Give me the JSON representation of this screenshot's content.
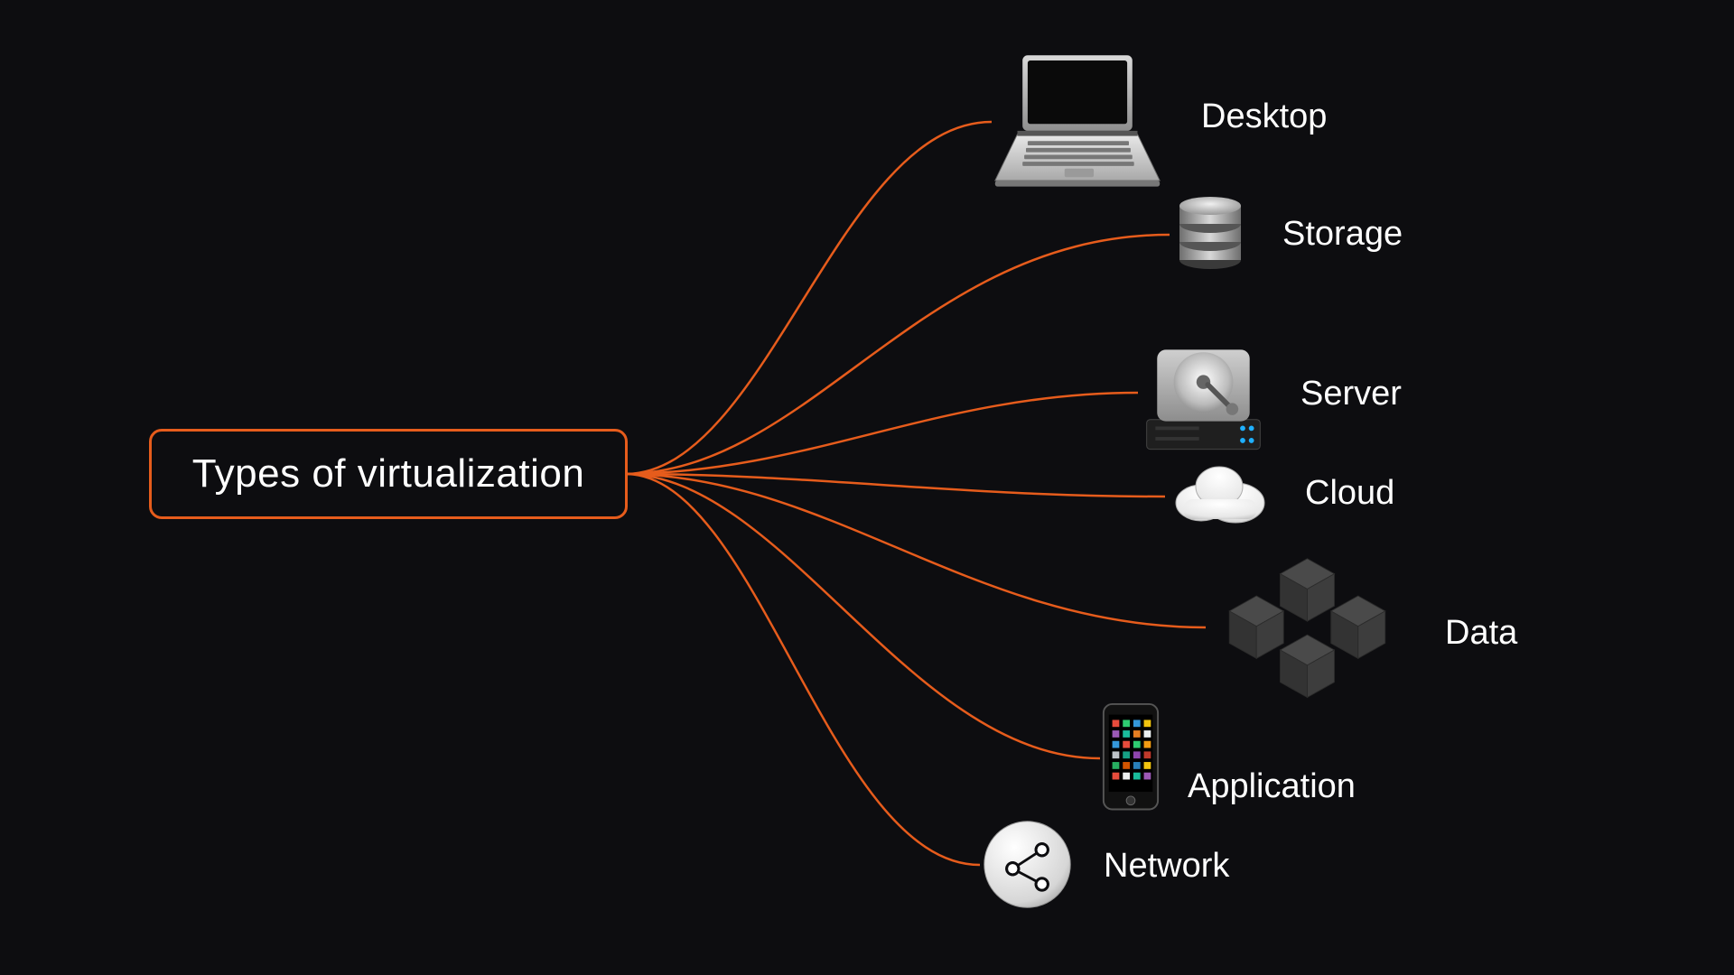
{
  "root": {
    "label": "Types of virtualization"
  },
  "branches": {
    "desktop": {
      "label": "Desktop",
      "icon": "laptop-icon"
    },
    "storage": {
      "label": "Storage",
      "icon": "database-icon"
    },
    "server": {
      "label": "Server",
      "icon": "server-drive-icon"
    },
    "cloud": {
      "label": "Cloud",
      "icon": "cloud-icon"
    },
    "data": {
      "label": "Data",
      "icon": "data-cubes-icon"
    },
    "application": {
      "label": "Application",
      "icon": "phone-apps-icon"
    },
    "network": {
      "label": "Network",
      "icon": "share-network-icon"
    }
  },
  "colors": {
    "accent": "#e65c1c",
    "bg": "#0d0d10",
    "text": "#ffffff"
  }
}
